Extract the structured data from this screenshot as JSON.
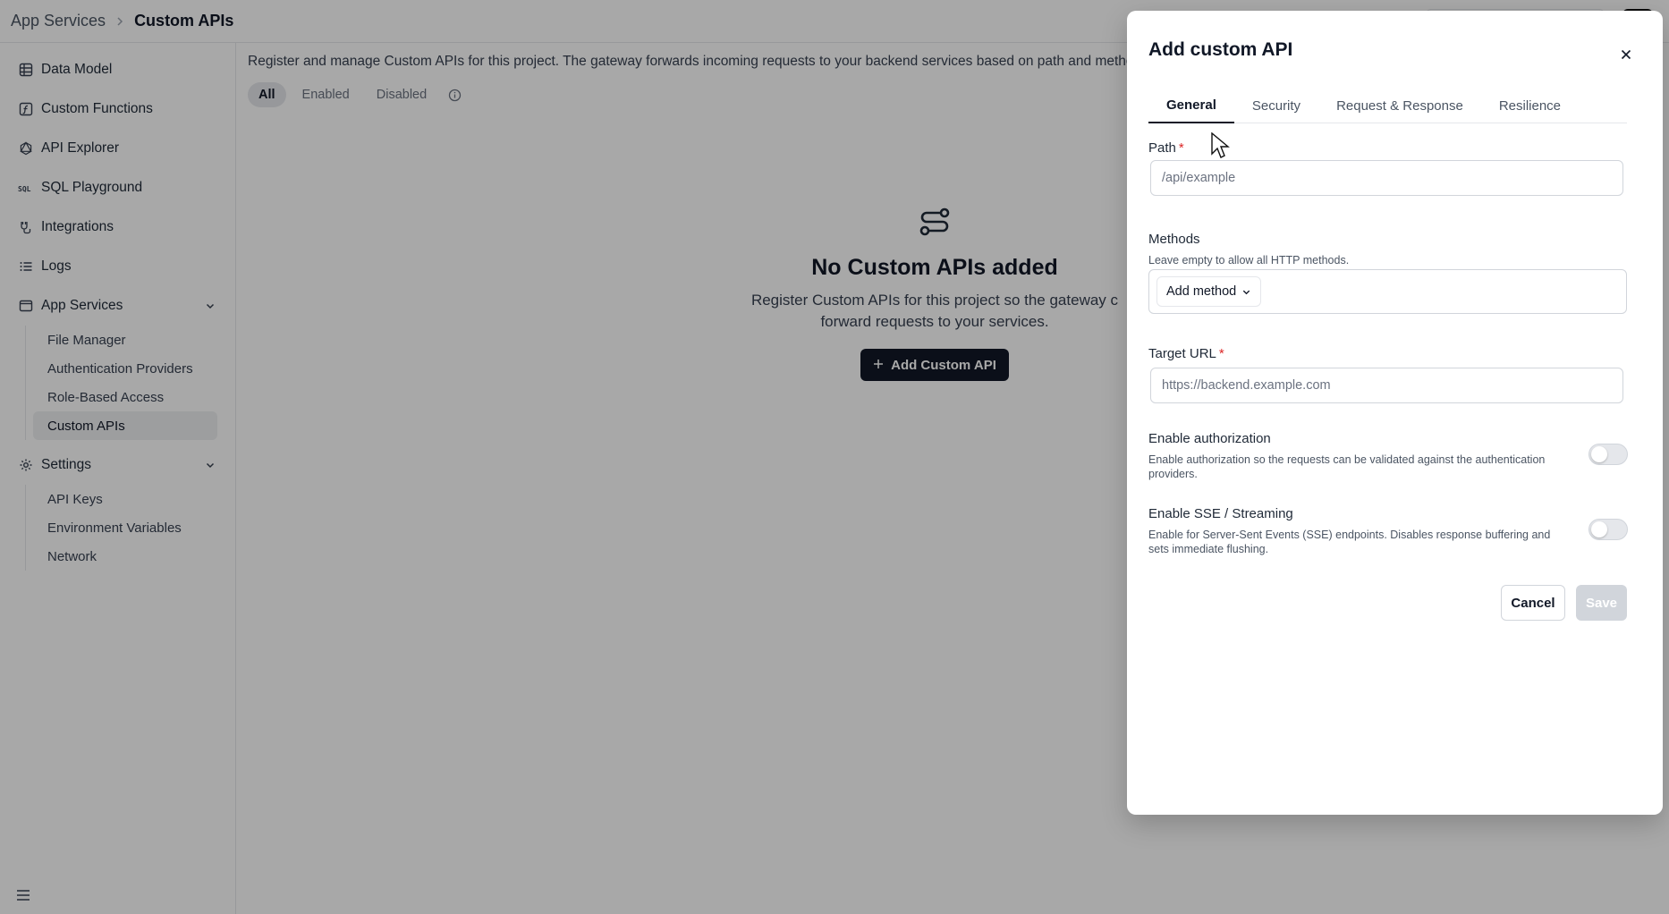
{
  "breadcrumb": {
    "root": "App Services",
    "current": "Custom APIs"
  },
  "sidebar": {
    "items": [
      {
        "label": "Data Model",
        "icon": "table-icon"
      },
      {
        "label": "Custom Functions",
        "icon": "function-icon"
      },
      {
        "label": "API Explorer",
        "icon": "graphql-icon"
      },
      {
        "label": "SQL Playground",
        "icon": "sql-icon"
      },
      {
        "label": "Integrations",
        "icon": "plug-icon"
      },
      {
        "label": "Logs",
        "icon": "list-icon"
      }
    ],
    "app_services": {
      "label": "App Services",
      "children": [
        "File Manager",
        "Authentication Providers",
        "Role-Based Access",
        "Custom APIs"
      ]
    },
    "settings": {
      "label": "Settings",
      "children": [
        "API Keys",
        "Environment Variables",
        "Network"
      ]
    }
  },
  "main": {
    "description": "Register and manage Custom APIs for this project. The gateway forwards incoming requests to your backend services based on path and method. C",
    "filters": [
      "All",
      "Enabled",
      "Disabled"
    ],
    "empty_title": "No Custom APIs added",
    "empty_desc_line1": "Register Custom APIs for this project so the gateway c",
    "empty_desc_line2": "forward requests to your services.",
    "add_button": "Add Custom API"
  },
  "dialog": {
    "title": "Add custom API",
    "tabs": [
      "General",
      "Security",
      "Request & Response",
      "Resilience"
    ],
    "path_label": "Path",
    "path_placeholder": "/api/example",
    "methods_label": "Methods",
    "methods_help": "Leave empty to allow all HTTP methods.",
    "add_method": "Add method",
    "target_label": "Target URL",
    "target_placeholder": "https://backend.example.com",
    "auth_label": "Enable authorization",
    "auth_help": "Enable authorization so the requests can be validated against the authentication providers.",
    "sse_label": "Enable SSE / Streaming",
    "sse_help": "Enable for Server-Sent Events (SSE) endpoints. Disables response buffering and sets immediate flushing.",
    "cancel": "Cancel",
    "save": "Save",
    "required_mark": "*"
  }
}
